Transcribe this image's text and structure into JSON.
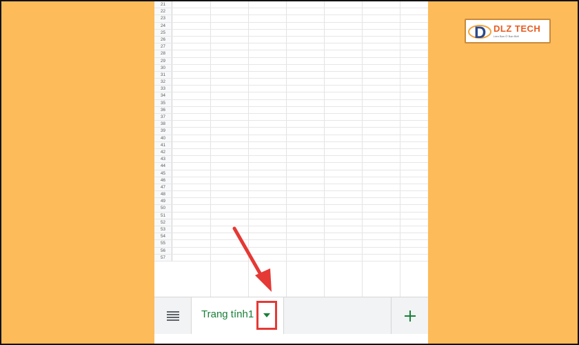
{
  "spreadsheet": {
    "row_numbers": [
      "21",
      "22",
      "23",
      "24",
      "25",
      "26",
      "27",
      "28",
      "29",
      "30",
      "31",
      "32",
      "33",
      "34",
      "35",
      "36",
      "37",
      "38",
      "39",
      "40",
      "41",
      "42",
      "43",
      "44",
      "45",
      "46",
      "47",
      "48",
      "49",
      "50",
      "51",
      "52",
      "53",
      "54",
      "55",
      "56",
      "57"
    ]
  },
  "bottom_bar": {
    "sheet_tab_label": "Trang tính1"
  },
  "logo": {
    "brand_text": "DLZ TECH",
    "tagline": "Làm Bạn Ở Bạn Biết"
  },
  "colors": {
    "background": "#FDBB5A",
    "tab_text": "#188038",
    "highlight": "#e53935",
    "logo_text": "#e85a1f"
  },
  "icons": {
    "menu": "list-lines-icon",
    "dropdown": "caret-down-icon",
    "add": "plus-icon",
    "pointer": "red-arrow-icon"
  }
}
